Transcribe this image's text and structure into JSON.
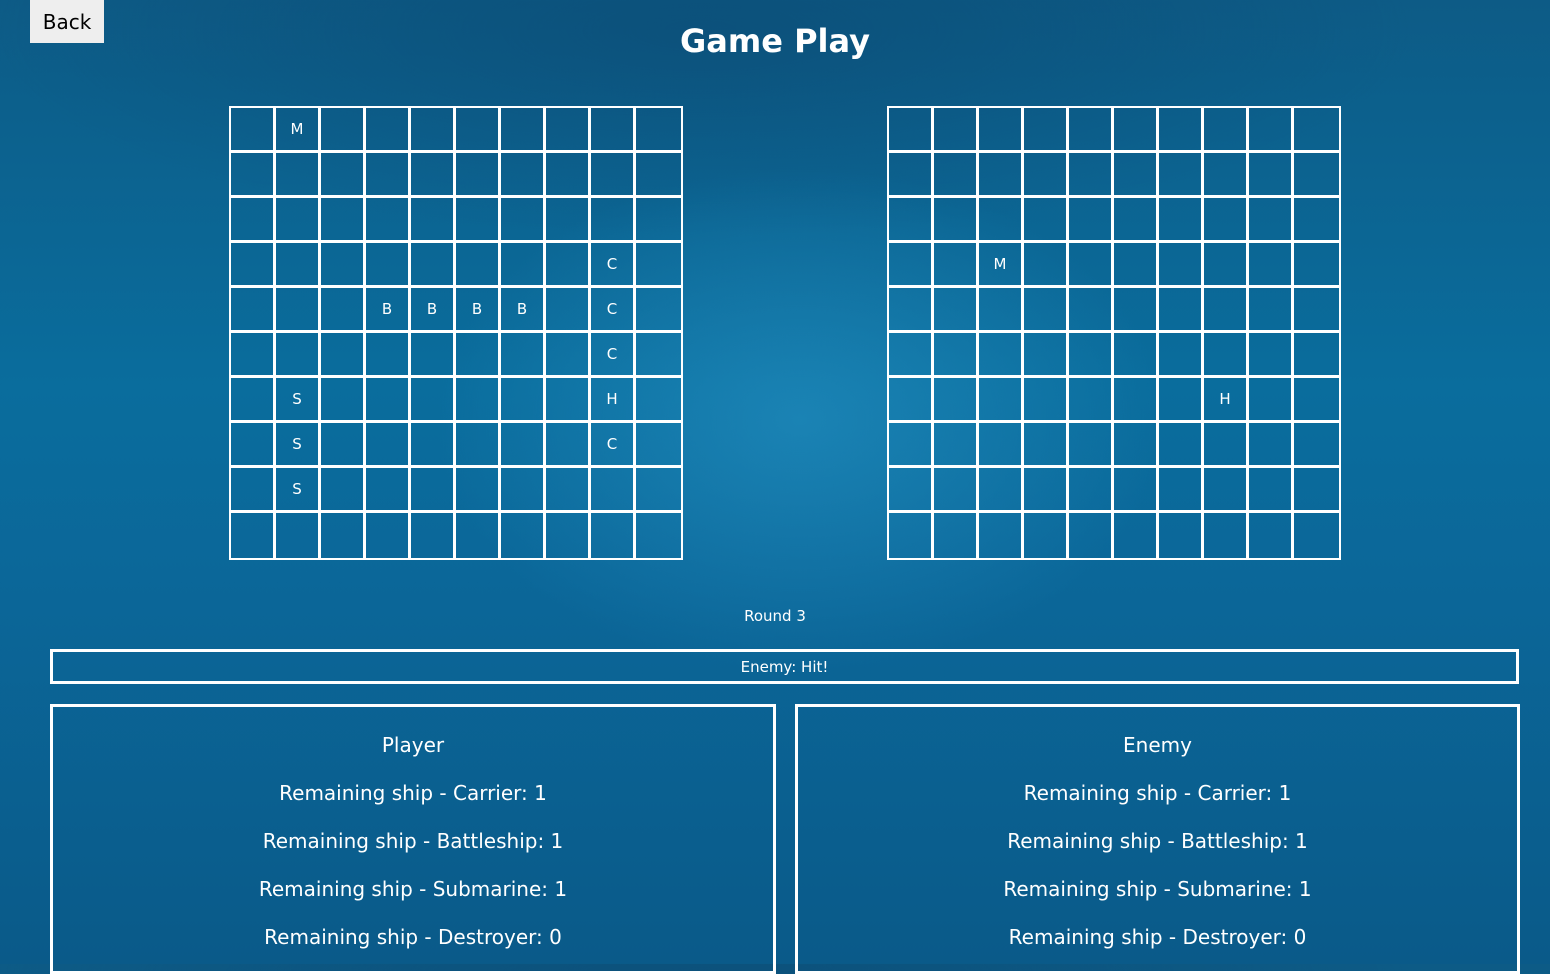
{
  "header": {
    "back_label": "Back",
    "title": "Game Play"
  },
  "player_board": {
    "marks": [
      {
        "row": 0,
        "col": 1,
        "text": "M"
      },
      {
        "row": 3,
        "col": 8,
        "text": "C"
      },
      {
        "row": 4,
        "col": 3,
        "text": "B"
      },
      {
        "row": 4,
        "col": 4,
        "text": "B"
      },
      {
        "row": 4,
        "col": 5,
        "text": "B"
      },
      {
        "row": 4,
        "col": 6,
        "text": "B"
      },
      {
        "row": 4,
        "col": 8,
        "text": "C"
      },
      {
        "row": 5,
        "col": 8,
        "text": "C"
      },
      {
        "row": 6,
        "col": 1,
        "text": "S"
      },
      {
        "row": 6,
        "col": 8,
        "text": "H"
      },
      {
        "row": 7,
        "col": 1,
        "text": "S"
      },
      {
        "row": 7,
        "col": 8,
        "text": "C"
      },
      {
        "row": 8,
        "col": 1,
        "text": "S"
      }
    ]
  },
  "enemy_board": {
    "marks": [
      {
        "row": 3,
        "col": 2,
        "text": "M"
      },
      {
        "row": 6,
        "col": 7,
        "text": "H"
      }
    ]
  },
  "round_label": "Round 3",
  "status_message": "Enemy: Hit!",
  "player_panel": {
    "title": "Player",
    "lines": [
      "Remaining ship - Carrier: 1",
      "Remaining ship - Battleship: 1",
      "Remaining ship - Submarine: 1",
      "Remaining ship - Destroyer: 0"
    ]
  },
  "enemy_panel": {
    "title": "Enemy",
    "lines": [
      "Remaining ship - Carrier: 1",
      "Remaining ship - Battleship: 1",
      "Remaining ship - Submarine: 1",
      "Remaining ship - Destroyer: 0"
    ]
  }
}
